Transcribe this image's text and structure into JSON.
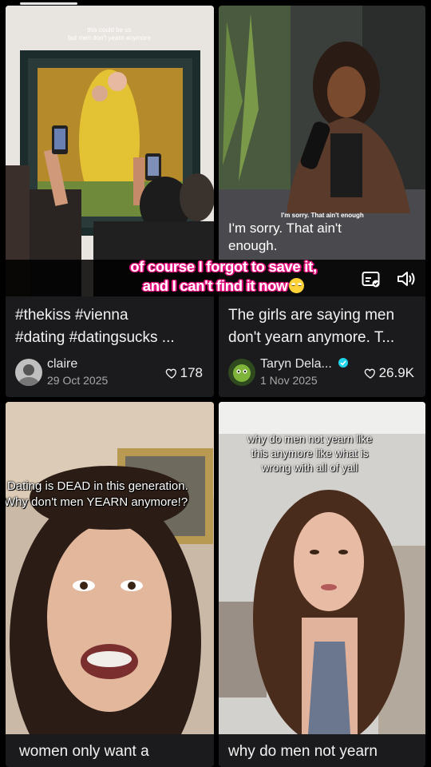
{
  "caption": {
    "line1": "of course I forgot to save it,",
    "line2": "and I can't find it now",
    "emoji": "rolling-eyes-emoji"
  },
  "overlay_icons": [
    "caption-icon",
    "sound-icon"
  ],
  "cards": [
    {
      "video_text": [
        "this could be us",
        "but men don't yearn anymore"
      ],
      "description": [
        "#thekiss #vienna",
        "#dating #datingsucks ..."
      ],
      "username": "claire",
      "date": "29 Oct 2025",
      "likes": "178"
    },
    {
      "video_text": [
        "I'm sorry. That ain't enough"
      ],
      "subtitle": [
        "I'm sorry. That ain't",
        "enough."
      ],
      "description": [
        "The girls are saying men",
        "don't yearn anymore. T..."
      ],
      "username": "Taryn Dela...",
      "verified": true,
      "date": "1 Nov 2025",
      "likes": "26.9K"
    },
    {
      "video_text": [
        "Dating is DEAD in this generation.",
        "Why don't men YEARN anymore!?"
      ],
      "description": [
        "women only want a"
      ]
    },
    {
      "video_text": [
        "why do men not yearn like",
        "this anymore like what is",
        "wrong with all of yall"
      ],
      "description": [
        "why do men not yearn"
      ]
    }
  ],
  "colors": {
    "background": "#000000",
    "card": "#1b1b1d",
    "caption_outline": "#e0137d",
    "verified": "#20d5ec"
  }
}
